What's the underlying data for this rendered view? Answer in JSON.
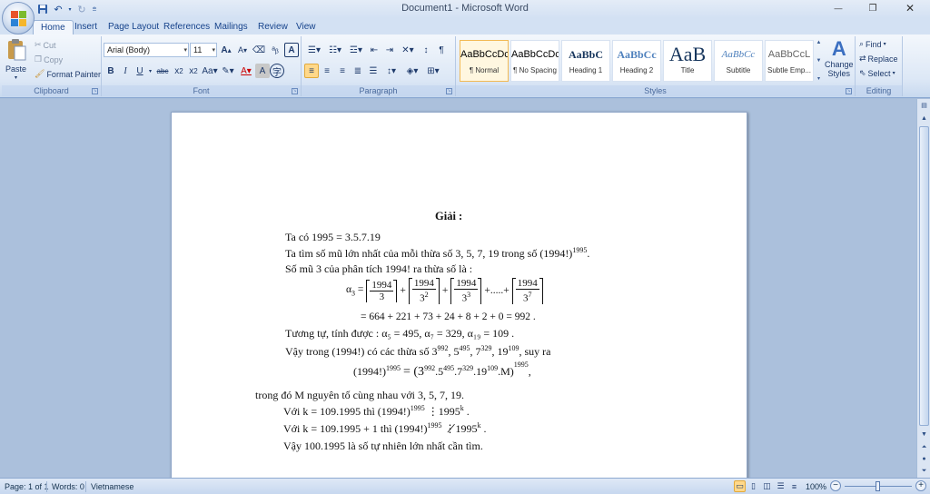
{
  "window": {
    "title": "Document1 - Microsoft Word",
    "minimize": "—",
    "restore": "❐",
    "close": "✕"
  },
  "tabs": [
    "Home",
    "Insert",
    "Page Layout",
    "References",
    "Mailings",
    "Review",
    "View"
  ],
  "clipboard": {
    "label": "Clipboard",
    "paste": "Paste",
    "cut": "Cut",
    "copy": "Copy",
    "format_painter": "Format Painter"
  },
  "font": {
    "label": "Font",
    "name": "Arial (Body)",
    "size": "11"
  },
  "paragraph": {
    "label": "Paragraph"
  },
  "styles": {
    "label": "Styles",
    "items": [
      {
        "sample": "AaBbCcDc",
        "name": "¶ Normal"
      },
      {
        "sample": "AaBbCcDc",
        "name": "¶ No Spacing"
      },
      {
        "sample": "AaBbC",
        "name": "Heading 1"
      },
      {
        "sample": "AaBbCc",
        "name": "Heading 2"
      },
      {
        "sample": "AaB",
        "name": "Title"
      },
      {
        "sample": "AaBbCc",
        "name": "Subtitle"
      },
      {
        "sample": "AaBbCcL",
        "name": "Subtle Emp..."
      }
    ],
    "change_styles_1": "Change",
    "change_styles_2": "Styles"
  },
  "editing": {
    "label": "Editing",
    "find": "Find",
    "replace": "Replace",
    "select": "Select"
  },
  "document": {
    "heading": "Giải :",
    "line1": "Ta có 1995 = 3.5.7.19",
    "line2a": "Ta tìm số mũ lớn nhất của mỗi thừa số 3, 5, 7, 19 trong số  (1994!)",
    "line2sup": "1995",
    "line2b": ".",
    "line3": "Số mũ 3 của phân tích 1994! ra thừa số là :",
    "alpha_lhs": "α",
    "alpha_sub": "3",
    "frac_num": "1994",
    "frac_den1": "3",
    "frac_den2": "3",
    "frac_den2_exp": "2",
    "frac_den3": "3",
    "frac_den3_exp": "3",
    "frac_den4": "3",
    "frac_den4_exp": "7",
    "sum_line": "= 664 + 221 + 73 + 24 + 8 + 2 + 0 = 992 .",
    "line5": "Tương tự, tính được :  α₅ = 495,  α₇ = 329,  α₁₉ = 109 .",
    "line6a": "Vậy trong (1994!) có các thừa số  3",
    "line6_e1": "992",
    "line6_b": ", 5",
    "line6_e2": "495",
    "line6_c": ", 7",
    "line6_e3": "329",
    "line6_d": ", 19",
    "line6_e4": "109",
    "line6_e": ", suy ra",
    "eq_lhs": "(1994!)",
    "eq_lhs_exp": "1995",
    "eq_rhs": "= (3",
    "eq_e1": "992",
    "eq_r2": ".5",
    "eq_e2": "495",
    "eq_r3": ".7",
    "eq_e3": "329",
    "eq_r4": ".19",
    "eq_e4": "109",
    "eq_r5": ".M)",
    "eq_outer_exp": "1995",
    "eq_end": ",",
    "line8": "trong đó M nguyên tố cùng nhau với 3, 5, 7, 19.",
    "line9a": "Với k = 109.1995 thì  (1994!)",
    "line9_e": "1995",
    "line9b": " ⋮1995",
    "line9_k": "k",
    "line9c": " .",
    "line10a": "Với k = 109.1995 + 1 thì  (1994!)",
    "line10_e": "1995",
    "line10b": " ⋮̸1995",
    "line10_k": "k",
    "line10c": " .",
    "line11": "Vậy 100.1995 là số tự nhiên lớn nhất cần tìm."
  },
  "status": {
    "page": "Page: 1 of 1",
    "words": "Words: 0",
    "language": "Vietnamese",
    "zoom": "100%"
  },
  "colors": {
    "ribbon_text": "#15428b",
    "workspace": "#abc0dc",
    "style_selected": "#f2ba55"
  }
}
